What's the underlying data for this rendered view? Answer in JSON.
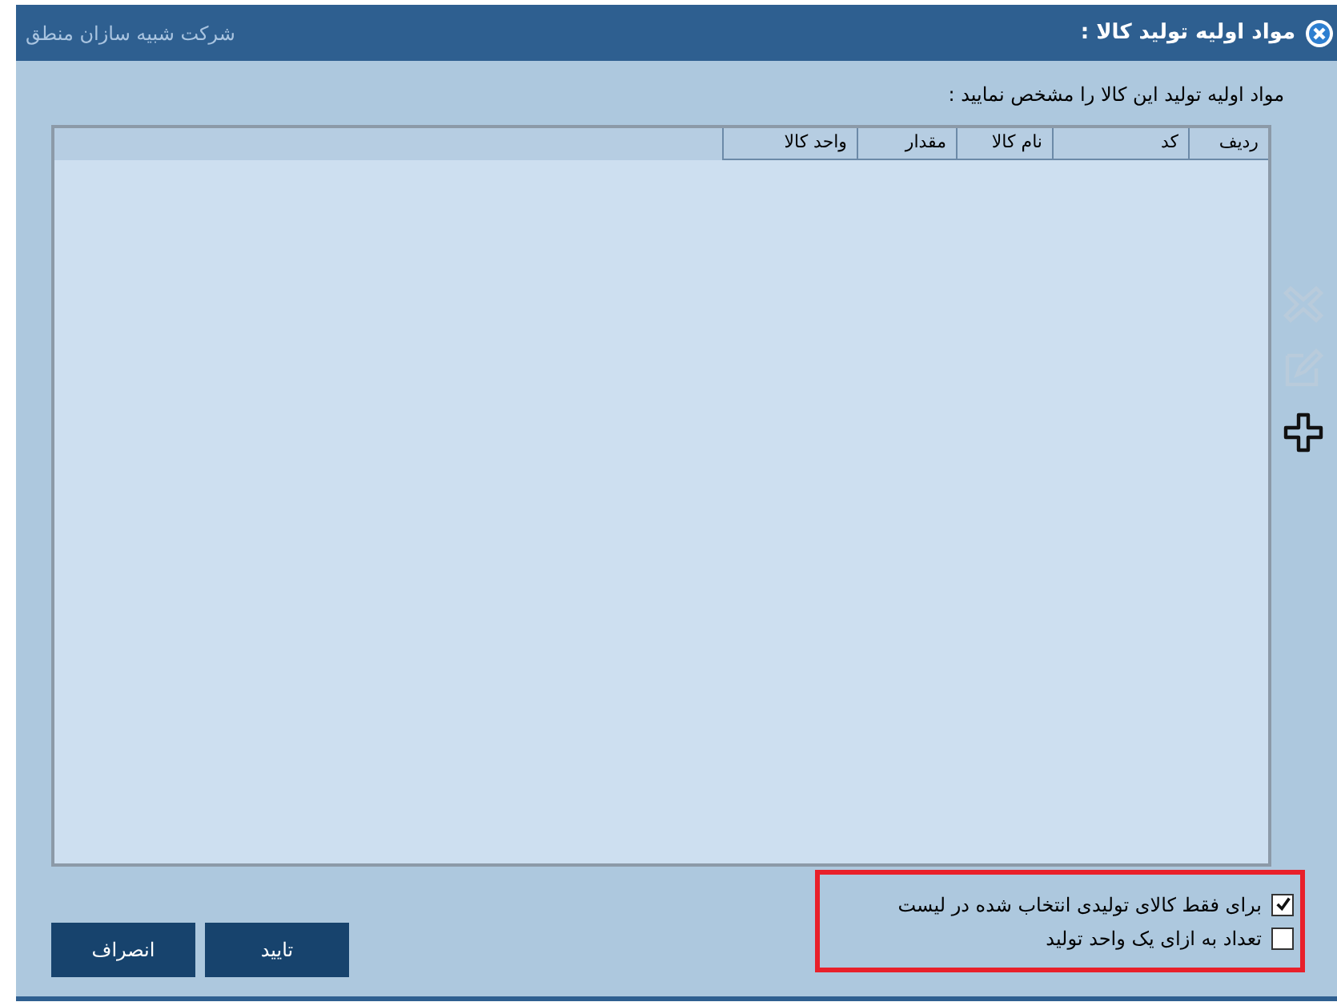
{
  "window": {
    "title": "مواد اولیه تولید کالا :",
    "company": "شرکت شبیه سازان منطق"
  },
  "instruction": "مواد اولیه تولید این کالا را مشخص نمایید :",
  "table": {
    "columns": [
      "ردیف",
      "کد",
      "نام کالا",
      "مقدار",
      "واحد کالا"
    ]
  },
  "tools": [
    {
      "kind": "delete",
      "disabled": true
    },
    {
      "kind": "edit",
      "disabled": true
    },
    {
      "kind": "add",
      "disabled": false
    }
  ],
  "options": [
    {
      "label": "برای فقط کالای تولیدی انتخاب شده در لیست",
      "checked": true
    },
    {
      "label": "تعداد به ازای یک واحد تولید",
      "checked": false
    }
  ],
  "buttons": [
    "تایید",
    "انصراف"
  ]
}
